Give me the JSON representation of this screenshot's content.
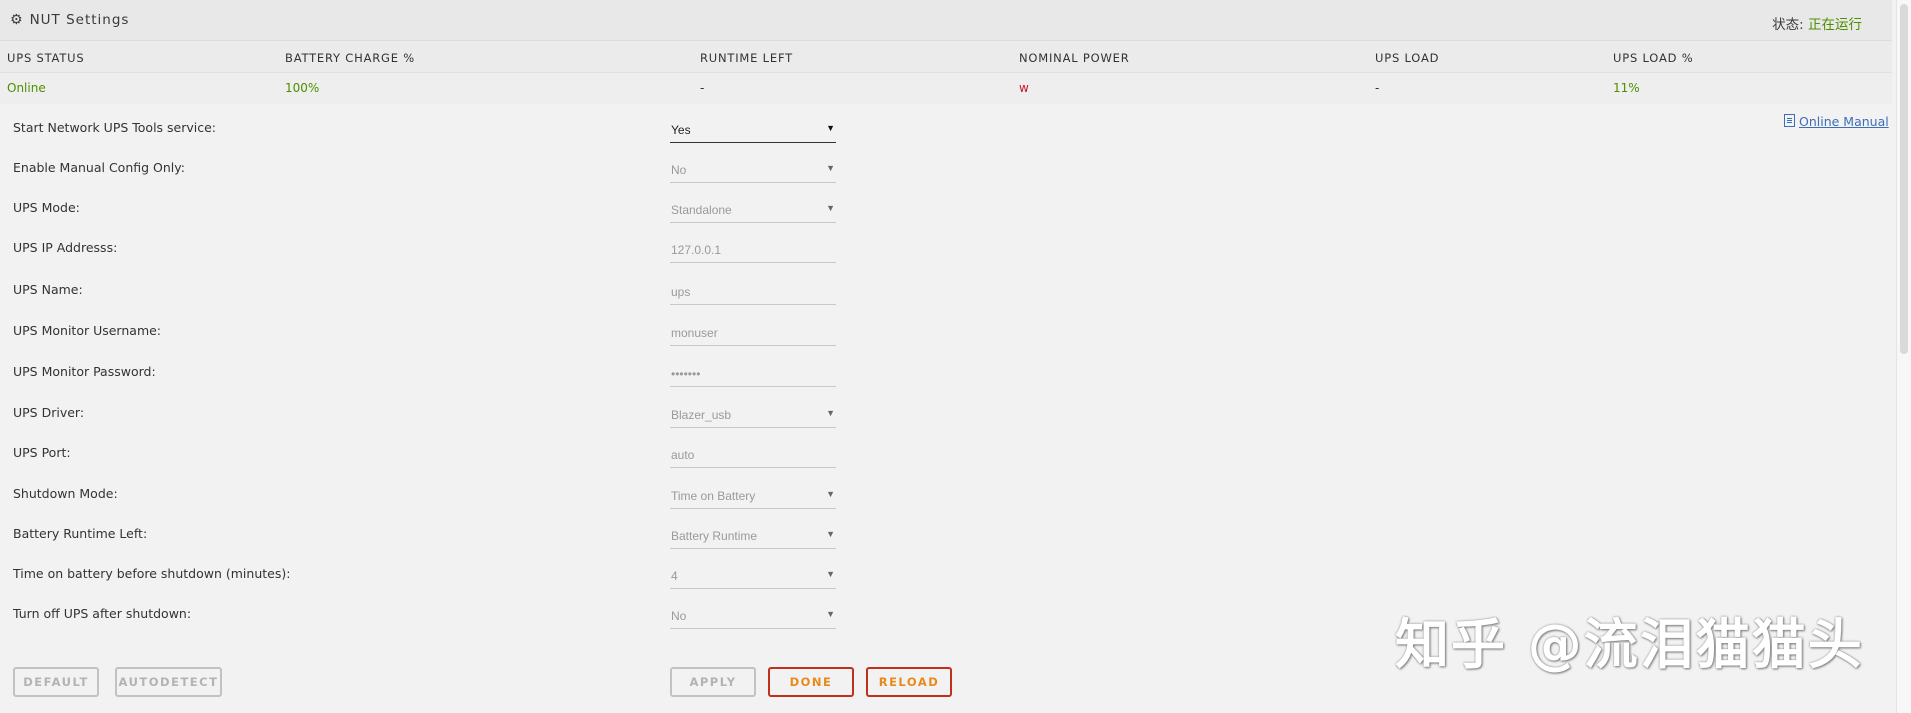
{
  "header": {
    "title": "NUT Settings",
    "status_label": "状态:",
    "status_value": "正在运行"
  },
  "table": {
    "headers": [
      "UPS STATUS",
      "BATTERY CHARGE %",
      "RUNTIME LEFT",
      "NOMINAL POWER",
      "UPS LOAD",
      "UPS LOAD %"
    ],
    "values": [
      "Online",
      "100%",
      "-",
      "w",
      "-",
      "11%"
    ]
  },
  "manual_link": "Online Manual",
  "fields": [
    {
      "label": "Start Network UPS Tools service:",
      "value": "Yes"
    },
    {
      "label": "Enable Manual Config Only:",
      "value": "No"
    },
    {
      "label": "UPS Mode:",
      "value": "Standalone"
    },
    {
      "label": "UPS IP Addresss:",
      "value": "127.0.0.1"
    },
    {
      "label": "UPS Name:",
      "value": "ups"
    },
    {
      "label": "UPS Monitor Username:",
      "value": "monuser"
    },
    {
      "label": "UPS Monitor Password:",
      "value": "•••••••"
    },
    {
      "label": "UPS Driver:",
      "value": "Blazer_usb"
    },
    {
      "label": "UPS Port:",
      "value": "auto"
    },
    {
      "label": "Shutdown Mode:",
      "value": "Time on Battery"
    },
    {
      "label": "Battery Runtime Left:",
      "value": "Battery Runtime"
    },
    {
      "label": "Time on battery before shutdown (minutes):",
      "value": "4"
    },
    {
      "label": "Turn off UPS after shutdown:",
      "value": "No"
    }
  ],
  "buttons": {
    "default": "DEFAULT",
    "autodetect": "AUTODETECT",
    "apply": "APPLY",
    "done": "DONE",
    "reload": "RELOAD"
  },
  "watermark": "知乎 @流泪猫猫头",
  "colors": {
    "status_green": "#4c8f00",
    "power_red": "#c8142a",
    "link_blue": "#3d6eb7",
    "button_orange": "#e88a1a",
    "button_border_red": "#c0301e"
  }
}
